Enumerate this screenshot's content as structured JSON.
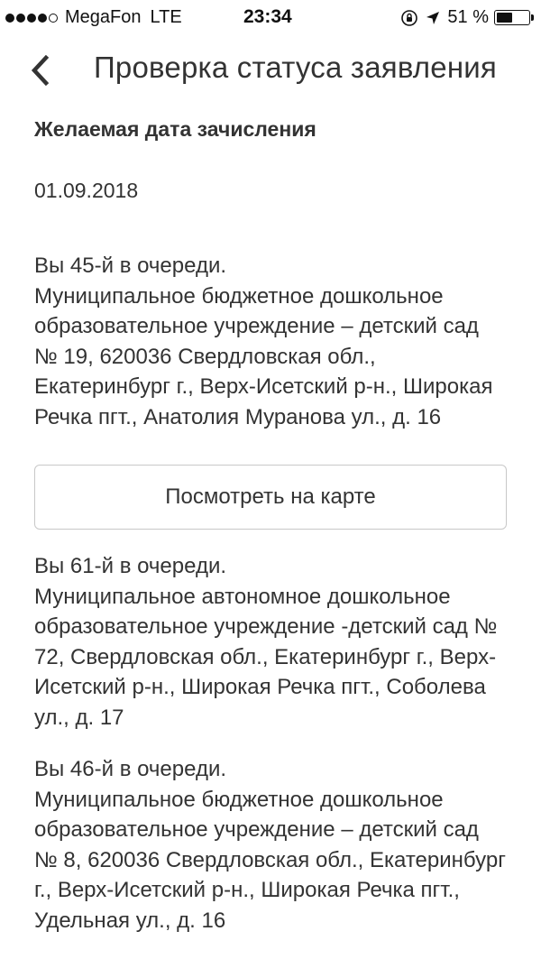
{
  "status_bar": {
    "carrier": "MegaFon",
    "network": "LTE",
    "time": "23:34",
    "battery_percent_label": "51 %",
    "battery_level": 0.51,
    "signal_bars_filled": 4,
    "signal_bars_total": 5,
    "icons": [
      "orientation-lock-icon",
      "location-arrow-icon",
      "battery-icon"
    ]
  },
  "nav": {
    "back_icon": "chevron-left-icon",
    "title": "Проверка статуса заявления"
  },
  "desired_date": {
    "heading": "Желаемая дата зачисления",
    "value": "01.09.2018"
  },
  "queue": [
    {
      "position": "Вы 45-й в очереди.",
      "address": "Муниципальное бюджетное дошкольное образовательное учреждение – детский сад № 19, 620036 Свердловская обл., Екатеринбург г., Верх-Исетский р-н., Широкая Речка пгт., Анатолия Муранова ул., д. 16"
    },
    {
      "position": "Вы 61-й в очереди.",
      "address": "Муниципальное автономное дошкольное образовательное учреждение -детский сад № 72, Свердловская обл., Екатеринбург г., Верх-Исетский р-н., Широкая Речка пгт., Соболева ул., д. 17"
    },
    {
      "position": "Вы 46-й в очереди.",
      "address": "Муниципальное бюджетное дошкольное образовательное учреждение – детский сад № 8, 620036 Свердловская обл., Екатеринбург г., Верх-Исетский р-н., Широкая Речка пгт., Удельная ул., д. 16"
    }
  ],
  "map_button": {
    "label": "Посмотреть на карте"
  }
}
